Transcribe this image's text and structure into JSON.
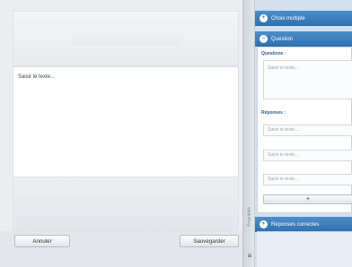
{
  "editor": {
    "placeholder": "Saisir le texte..."
  },
  "footer": {
    "cancel_label": "Annuler",
    "save_label": "Sauvegarder"
  },
  "strip": {
    "label": "Propriétés",
    "grip_glyph": "≡"
  },
  "panel": {
    "sections": [
      {
        "label": "Choix multiple",
        "icon": "plus-icon",
        "glyph": "+"
      },
      {
        "label": "Question",
        "icon": "minus-icon",
        "glyph": "−"
      },
      {
        "label": "Réponses correctes",
        "icon": "plus-icon",
        "glyph": "+"
      }
    ],
    "questions_label": "Questions :",
    "question_placeholder": "Saisir le texte...",
    "responses_label": "Réponses :",
    "response_placeholders": [
      "Saisir le texte...",
      "Saisir le texte...",
      "Saisir le texte..."
    ],
    "add_glyph": "+"
  },
  "colors": {
    "header_blue": "#2e6fae",
    "panel_bg": "#d4e0ee"
  }
}
